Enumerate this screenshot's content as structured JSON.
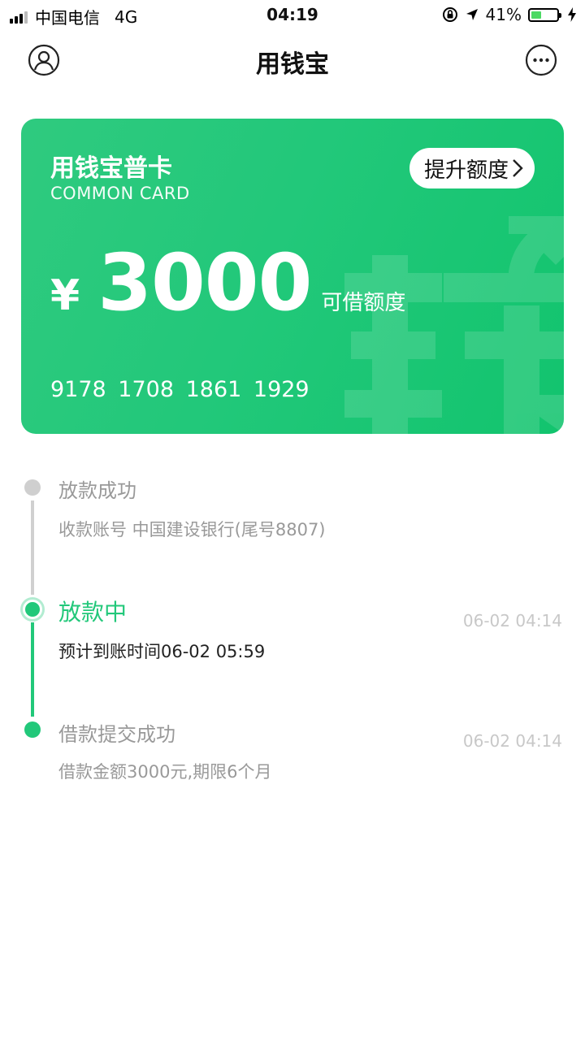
{
  "status_bar": {
    "carrier": "中国电信",
    "network": "4G",
    "time": "04:19",
    "battery_percent": "41%",
    "battery_level": 0.41,
    "icons": [
      "signal-icon",
      "orientation-lock-icon",
      "location-arrow-icon",
      "battery-icon",
      "charging-bolt-icon"
    ]
  },
  "nav": {
    "title": "用钱宝",
    "left_icon": "user-profile-icon",
    "right_icon": "more-options-icon"
  },
  "card": {
    "name": "用钱宝普卡",
    "subtitle": "COMMON CARD",
    "boost_button": "提升额度",
    "currency": "¥",
    "amount": "3000",
    "amount_label": "可借额度",
    "number": "9178 1708 1861 1929",
    "watermark_icon": "money-coin-watermark-icon",
    "color": "#22c87a"
  },
  "timeline": [
    {
      "title": "放款成功",
      "desc": "收款账号 中国建设银行(尾号8807)",
      "time": "",
      "state": "pending"
    },
    {
      "title": "放款中",
      "desc": "预计到账时间06-02 05:59",
      "time": "06-02 04:14",
      "state": "current"
    },
    {
      "title": "借款提交成功",
      "desc": "借款金额3000元,期限6个月",
      "time": "06-02 04:14",
      "state": "done"
    }
  ],
  "colors": {
    "accent": "#22c87a",
    "muted_text": "#999999",
    "timestamp": "#c8c8c8"
  }
}
